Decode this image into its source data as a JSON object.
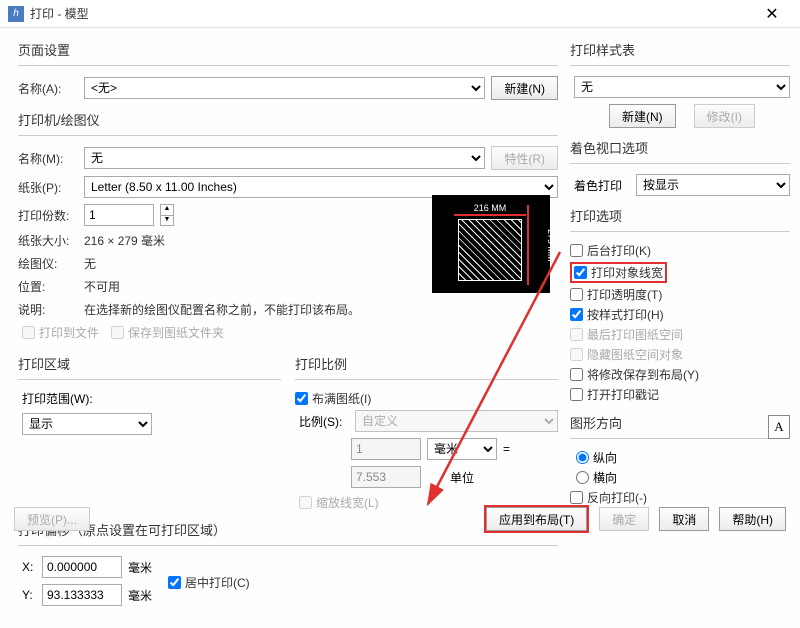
{
  "title": "打印 - 模型",
  "page_setup": {
    "header": "页面设置",
    "name_label": "名称(A):",
    "name_value": "<无>",
    "new_btn": "新建(N)"
  },
  "printer": {
    "header": "打印机/绘图仪",
    "name_label": "名称(M):",
    "name_value": "无",
    "props_btn": "特性(R)",
    "paper_label": "纸张(P):",
    "paper_value": "Letter (8.50 x 11.00 Inches)",
    "copies_label": "打印份数:",
    "copies_value": "1",
    "size_label": "纸张大小:",
    "size_value": "216 × 279  毫米",
    "plotter_label": "绘图仪:",
    "plotter_value": "无",
    "pos_label": "位置:",
    "pos_value": "不可用",
    "desc_label": "说明:",
    "desc_value": "在选择新的绘图仪配置名称之前，不能打印该布局。",
    "to_file": "打印到文件",
    "save_to": "保存到图纸文件夹",
    "dim_w": "216 MM",
    "dim_h": "279 MM"
  },
  "area": {
    "header": "打印区域",
    "range_label": "打印范围(W):",
    "range_value": "显示"
  },
  "scale": {
    "header": "打印比例",
    "fit": "布满图纸(I)",
    "ratio_label": "比例(S):",
    "ratio_value": "自定义",
    "num": "1",
    "unit_sel": "毫米",
    "eq": "=",
    "den": "7.553",
    "unit_lbl": "单位",
    "scale_lw": "缩放线宽(L)"
  },
  "offset": {
    "header": "打印偏移（原点设置在可打印区域）",
    "x": "X:",
    "xv": "0.000000",
    "mm": "毫米",
    "y": "Y:",
    "yv": "93.133333",
    "center": "居中打印(C)"
  },
  "styles": {
    "header": "打印样式表",
    "value": "无",
    "new_btn": "新建(N)",
    "edit_btn": "修改(I)"
  },
  "vp": {
    "header": "着色视口选项",
    "shade_label": "着色打印",
    "shade_value": "按显示"
  },
  "options": {
    "header": "打印选项",
    "bg": "后台打印(K)",
    "lw": "打印对象线宽",
    "trans": "打印透明度(T)",
    "style": "按样式打印(H)",
    "last": "最后打印图纸空间",
    "hide": "隐藏图纸空间对象",
    "save": "将修改保存到布局(Y)",
    "stamp": "打开打印戳记"
  },
  "orient": {
    "header": "图形方向",
    "portrait": "纵向",
    "landscape": "横向",
    "reverse": "反向打印(-)"
  },
  "footer": {
    "preview": "预览(P)...",
    "apply": "应用到布局(T)",
    "ok": "确定",
    "cancel": "取消",
    "help": "帮助(H)"
  }
}
